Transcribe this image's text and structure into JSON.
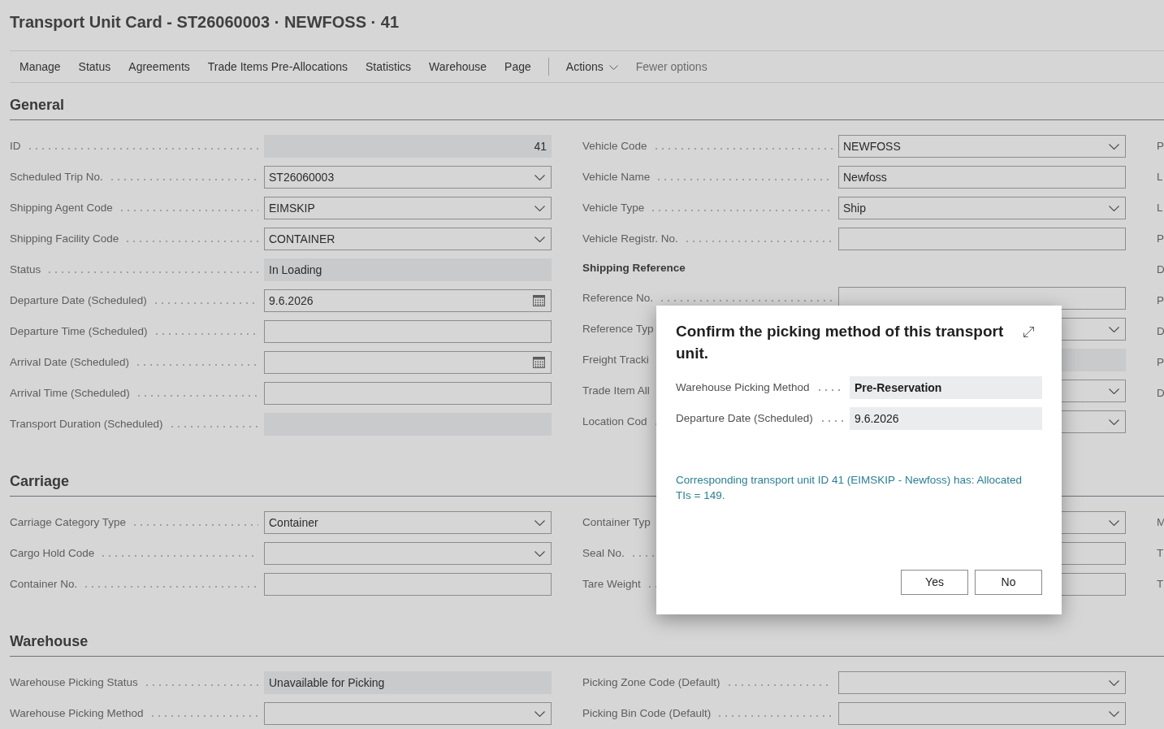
{
  "page": {
    "title": "Transport Unit Card - ST26060003 · NEWFOSS · 41"
  },
  "action_bar": [
    {
      "label": "Manage",
      "kind": "menu"
    },
    {
      "label": "Status",
      "kind": "menu"
    },
    {
      "label": "Agreements",
      "kind": "menu"
    },
    {
      "label": "Trade Items Pre-Allocations",
      "kind": "menu"
    },
    {
      "label": "Statistics",
      "kind": "menu"
    },
    {
      "label": "Warehouse",
      "kind": "menu"
    },
    {
      "label": "Page",
      "kind": "menu"
    },
    {
      "label": "Actions",
      "kind": "dropdown"
    },
    {
      "label": "Fewer options",
      "kind": "toggle"
    }
  ],
  "sections": [
    {
      "title": "General",
      "columns": [
        {
          "rows": [
            {
              "kind": "field",
              "label": "ID",
              "field": {
                "kind": "number",
                "value": "41"
              }
            },
            {
              "kind": "field",
              "label": "Scheduled Trip No.",
              "field": {
                "kind": "dropdown",
                "value": "ST26060003"
              }
            },
            {
              "kind": "field",
              "label": "Shipping Agent Code",
              "field": {
                "kind": "dropdown",
                "value": "EIMSKIP"
              }
            },
            {
              "kind": "field",
              "label": "Shipping Facility Code",
              "field": {
                "kind": "dropdown",
                "value": "CONTAINER"
              }
            },
            {
              "kind": "field",
              "label": "Status",
              "field": {
                "kind": "readonly",
                "value": "In Loading"
              }
            },
            {
              "kind": "field",
              "label": "Departure Date (Scheduled)",
              "field": {
                "kind": "date",
                "value": "9.6.2026"
              }
            },
            {
              "kind": "field",
              "label": "Departure Time (Scheduled)",
              "field": {
                "kind": "text"
              }
            },
            {
              "kind": "field",
              "label": "Arrival Date (Scheduled)",
              "field": {
                "kind": "date"
              }
            },
            {
              "kind": "field",
              "label": "Arrival Time (Scheduled)",
              "field": {
                "kind": "text"
              }
            },
            {
              "kind": "field",
              "label": "Transport Duration (Scheduled)",
              "field": {
                "kind": "readonly"
              }
            }
          ]
        },
        {
          "rows": [
            {
              "kind": "field",
              "label": "Vehicle Code",
              "field": {
                "kind": "dropdown",
                "value": "NEWFOSS"
              }
            },
            {
              "kind": "field",
              "label": "Vehicle Name",
              "field": {
                "kind": "text",
                "value": "Newfoss"
              }
            },
            {
              "kind": "field",
              "label": "Vehicle Type",
              "field": {
                "kind": "dropdown",
                "value": "Ship"
              }
            },
            {
              "kind": "field",
              "label": "Vehicle Registr. No.",
              "field": {
                "kind": "text"
              }
            },
            {
              "kind": "heading",
              "label": "Shipping Reference"
            },
            {
              "kind": "field",
              "label": "Reference No.",
              "field": {
                "kind": "text"
              }
            },
            {
              "kind": "field",
              "label": "Reference Typ",
              "field": {
                "kind": "dropdown"
              }
            },
            {
              "kind": "field",
              "label": "Freight Tracki",
              "field": {
                "kind": "readonly"
              }
            },
            {
              "kind": "field",
              "label": "Trade Item All",
              "field": {
                "kind": "dropdown"
              }
            },
            {
              "kind": "field",
              "label": "Location Cod",
              "field": {
                "kind": "dropdown"
              }
            }
          ]
        },
        {
          "rows": [
            {
              "kind": "label",
              "label": "P"
            },
            {
              "kind": "label",
              "label": "L"
            },
            {
              "kind": "label",
              "label": "L"
            },
            {
              "kind": "label",
              "label": "P"
            },
            {
              "kind": "label",
              "label": "D"
            },
            {
              "kind": "label",
              "label": "P"
            },
            {
              "kind": "label",
              "label": "D"
            },
            {
              "kind": "label",
              "label": "P"
            },
            {
              "kind": "label",
              "label": "D"
            }
          ]
        }
      ]
    },
    {
      "title": "Carriage",
      "columns": [
        {
          "rows": [
            {
              "kind": "field",
              "label": "Carriage Category Type",
              "field": {
                "kind": "dropdown",
                "value": "Container"
              }
            },
            {
              "kind": "field",
              "label": "Cargo Hold Code",
              "field": {
                "kind": "dropdown"
              }
            },
            {
              "kind": "field",
              "label": "Container No.",
              "field": {
                "kind": "text"
              }
            }
          ]
        },
        {
          "rows": [
            {
              "kind": "field",
              "label": "Container Typ",
              "field": {
                "kind": "dropdown"
              }
            },
            {
              "kind": "field",
              "label": "Seal No.",
              "field": {
                "kind": "text"
              }
            },
            {
              "kind": "field",
              "label": "Tare Weight",
              "field": {
                "kind": "text"
              }
            }
          ]
        },
        {
          "rows": [
            {
              "kind": "label",
              "label": "M"
            },
            {
              "kind": "label",
              "label": "T"
            },
            {
              "kind": "label",
              "label": "T"
            }
          ]
        }
      ]
    },
    {
      "title": "Warehouse",
      "columns": [
        {
          "rows": [
            {
              "kind": "field",
              "label": "Warehouse Picking Status",
              "field": {
                "kind": "readonly",
                "value": "Unavailable for Picking"
              }
            },
            {
              "kind": "field",
              "label": "Warehouse Picking Method",
              "field": {
                "kind": "dropdown"
              }
            }
          ]
        },
        {
          "rows": [
            {
              "kind": "field",
              "label": "Picking Zone Code (Default)",
              "field": {
                "kind": "dropdown"
              }
            },
            {
              "kind": "field",
              "label": "Picking Bin Code (Default)",
              "field": {
                "kind": "dropdown"
              }
            }
          ]
        }
      ]
    }
  ],
  "dialog": {
    "title": "Confirm the picking method of this transport unit.",
    "fields": [
      {
        "label": "Warehouse Picking Method",
        "value": "Pre-Reservation",
        "bold": true
      },
      {
        "label": "Departure Date (Scheduled)",
        "value": "9.6.2026",
        "bold": false
      }
    ],
    "message": "Corresponding transport unit ID 41 (EIMSKIP - Newfoss) has: Allocated TIs = 149.",
    "buttons": [
      "Yes",
      "No"
    ]
  }
}
